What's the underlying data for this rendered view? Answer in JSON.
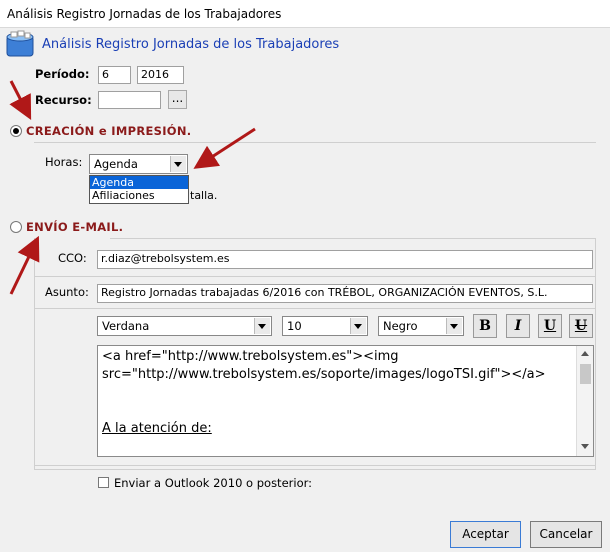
{
  "window": {
    "title": "Análisis Registro Jornadas de los Trabajadores"
  },
  "header": {
    "title": "Análisis Registro Jornadas de los Trabajadores",
    "icon": "database-icon"
  },
  "periodo": {
    "label": "Período:",
    "month": "6",
    "year": "2016"
  },
  "recurso": {
    "label": "Recurso:",
    "value": "",
    "browse_label": "..."
  },
  "creacion": {
    "label": "CREACIÓN e IMPRESIÓN.",
    "selected": true,
    "horas_label": "Horas:",
    "horas_value": "Agenda",
    "horas_options": [
      "Agenda",
      "Afiliaciones"
    ],
    "hidden_text_tail": "talla."
  },
  "envio": {
    "label": "ENVÍO E-MAIL.",
    "selected": false,
    "cco_label": "CCO:",
    "cco_value": "r.diaz@trebolsystem.es",
    "asunto_label": "Asunto:",
    "asunto_value": "Registro Jornadas trabajadas 6/2016 con TRÉBOL, ORGANIZACIÓN EVENTOS, S.L.",
    "font_value": "Verdana",
    "size_value": "10",
    "color_value": "Negro",
    "bold_label": "B",
    "italic_label": "I",
    "underline_label": "U",
    "strike_label": "U",
    "editor_line1": "<a href=\"http://www.trebolsystem.es\"><img",
    "editor_line2": "src=\"http://www.trebolsystem.es/soporte/images/logoTSI.gif\"></a>",
    "editor_line3": "A la atención de:",
    "outlook_label": "Enviar a Outlook 2010 o posterior:",
    "outlook_checked": false
  },
  "buttons": {
    "accept": "Aceptar",
    "cancel": "Cancelar"
  },
  "colors": {
    "header_title": "#1a3fb5",
    "section_title": "#8b1a1a",
    "annotation_arrow": "#b01818",
    "selection": "#0a64d8"
  }
}
